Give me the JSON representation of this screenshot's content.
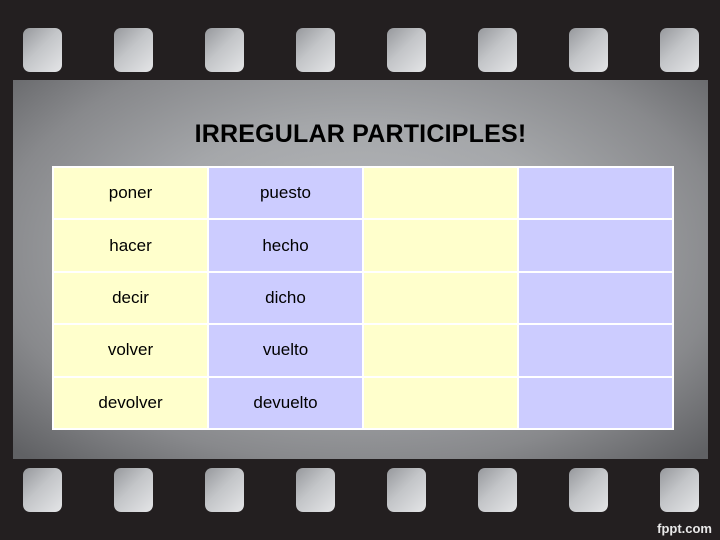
{
  "slide": {
    "title": "IRREGULAR PARTICIPLES!",
    "watermark": "fppt.com",
    "colors": {
      "background": "#231f20",
      "infinitive_cell": "#ffffcc",
      "participle_cell": "#ccccff",
      "grid_line": "#ffffff"
    }
  },
  "table": {
    "rows": [
      {
        "infinitive": "poner",
        "participle": "puesto",
        "col3": "",
        "col4": ""
      },
      {
        "infinitive": "hacer",
        "participle": "hecho",
        "col3": "",
        "col4": ""
      },
      {
        "infinitive": "decir",
        "participle": "dicho",
        "col3": "",
        "col4": ""
      },
      {
        "infinitive": "volver",
        "participle": "vuelto",
        "col3": "",
        "col4": ""
      },
      {
        "infinitive": "devolver",
        "participle": "devuelto",
        "col3": "",
        "col4": ""
      }
    ]
  }
}
